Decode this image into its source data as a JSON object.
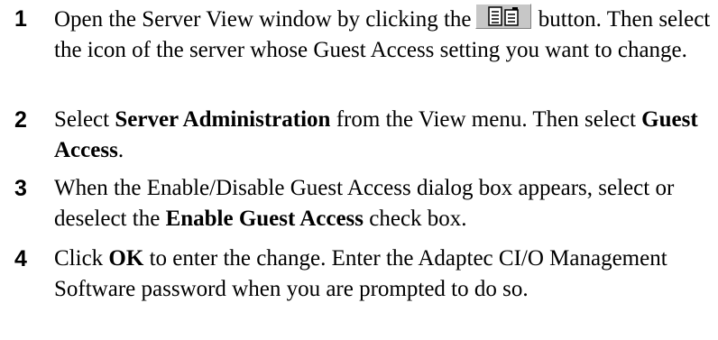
{
  "steps": [
    {
      "number": "1",
      "text_before_icon": "Open the Server View window by clicking the",
      "icon": "server-view-icon",
      "text_after_icon": " button. Then select the icon of the server whose Guest Access setting you want to change."
    },
    {
      "number": "2",
      "text_a": "Select ",
      "bold_a": "Server Administration",
      "text_b": " from the View menu. Then select ",
      "bold_b": "Guest Access",
      "text_c": "."
    },
    {
      "number": "3",
      "text_a": "When the Enable/Disable Guest Access dialog box appears, select or deselect the ",
      "bold_a": "Enable Guest Access",
      "text_b": " check box."
    },
    {
      "number": "4",
      "text_a": "Click ",
      "bold_a": "OK",
      "text_b": " to enter the change. Enter the Adaptec CI/O Management Software password when you are prompted to do so."
    }
  ]
}
